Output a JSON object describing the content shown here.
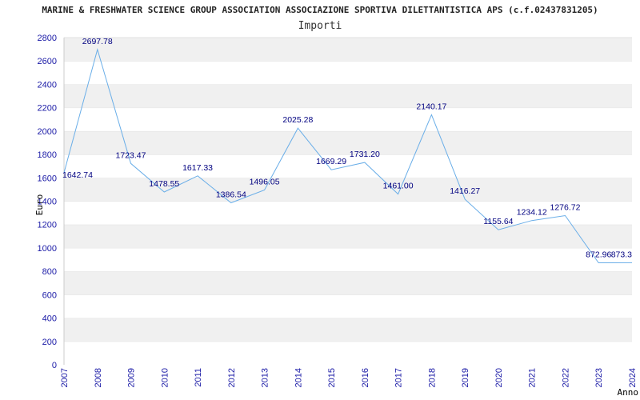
{
  "title": "MARINE & FRESHWATER SCIENCE GROUP ASSOCIATION ASSOCIAZIONE SPORTIVA DILETTANTISTICA APS (c.f.02437831205)",
  "subtitle": "Importi",
  "colors": {
    "line": "#6aaee8",
    "band": "#f0f0f0",
    "ticks": "#1a1aa6",
    "labels": "#000080"
  },
  "chart_data": {
    "type": "line",
    "title": "MARINE & FRESHWATER SCIENCE GROUP ASSOCIATION ASSOCIAZIONE SPORTIVA DILETTANTISTICA APS (c.f.02437831205)",
    "subtitle": "Importi",
    "xlabel": "Anno",
    "ylabel": "Euro",
    "x": [
      "2007",
      "2008",
      "2009",
      "2010",
      "2011",
      "2012",
      "2013",
      "2014",
      "2015",
      "2016",
      "2017",
      "2018",
      "2019",
      "2020",
      "2021",
      "2022",
      "2023",
      "2024"
    ],
    "series": [
      {
        "values": [
          1642.74,
          2697.78,
          1723.47,
          1478.55,
          1617.33,
          1386.54,
          1496.05,
          2025.28,
          1669.29,
          1731.2,
          1461.0,
          2140.17,
          1416.27,
          1155.64,
          1234.12,
          1276.72,
          872.96,
          873.3
        ]
      }
    ],
    "data_labels": [
      "1642.74",
      "2697.78",
      "1723.47",
      "1478.55",
      "1617.33",
      "1386.54",
      "1496.05",
      "2025.28",
      "1669.29",
      "1731.20",
      "1461.00",
      "2140.17",
      "1416.27",
      "1155.64",
      "1234.12",
      "1276.72",
      "872.96",
      "873.3"
    ],
    "y_ticks": [
      "0",
      "200",
      "400",
      "600",
      "800",
      "1000",
      "1200",
      "1400",
      "1600",
      "1800",
      "2000",
      "2200",
      "2400",
      "2600",
      "2800"
    ],
    "ylim": [
      0,
      2800
    ],
    "grid": "alternating horizontal bands",
    "legend": "none"
  }
}
